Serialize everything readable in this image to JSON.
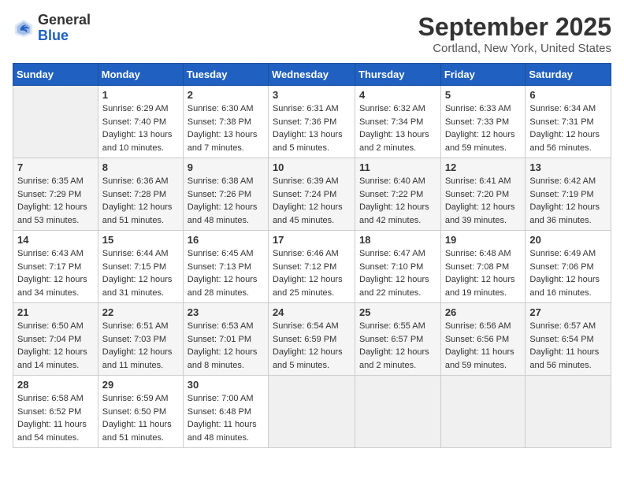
{
  "logo": {
    "general": "General",
    "blue": "Blue"
  },
  "title": "September 2025",
  "location": "Cortland, New York, United States",
  "days_of_week": [
    "Sunday",
    "Monday",
    "Tuesday",
    "Wednesday",
    "Thursday",
    "Friday",
    "Saturday"
  ],
  "weeks": [
    [
      {
        "num": "",
        "sunrise": "",
        "sunset": "",
        "daylight": "",
        "empty": true
      },
      {
        "num": "1",
        "sunrise": "Sunrise: 6:29 AM",
        "sunset": "Sunset: 7:40 PM",
        "daylight": "Daylight: 13 hours and 10 minutes."
      },
      {
        "num": "2",
        "sunrise": "Sunrise: 6:30 AM",
        "sunset": "Sunset: 7:38 PM",
        "daylight": "Daylight: 13 hours and 7 minutes."
      },
      {
        "num": "3",
        "sunrise": "Sunrise: 6:31 AM",
        "sunset": "Sunset: 7:36 PM",
        "daylight": "Daylight: 13 hours and 5 minutes."
      },
      {
        "num": "4",
        "sunrise": "Sunrise: 6:32 AM",
        "sunset": "Sunset: 7:34 PM",
        "daylight": "Daylight: 13 hours and 2 minutes."
      },
      {
        "num": "5",
        "sunrise": "Sunrise: 6:33 AM",
        "sunset": "Sunset: 7:33 PM",
        "daylight": "Daylight: 12 hours and 59 minutes."
      },
      {
        "num": "6",
        "sunrise": "Sunrise: 6:34 AM",
        "sunset": "Sunset: 7:31 PM",
        "daylight": "Daylight: 12 hours and 56 minutes."
      }
    ],
    [
      {
        "num": "7",
        "sunrise": "Sunrise: 6:35 AM",
        "sunset": "Sunset: 7:29 PM",
        "daylight": "Daylight: 12 hours and 53 minutes."
      },
      {
        "num": "8",
        "sunrise": "Sunrise: 6:36 AM",
        "sunset": "Sunset: 7:28 PM",
        "daylight": "Daylight: 12 hours and 51 minutes."
      },
      {
        "num": "9",
        "sunrise": "Sunrise: 6:38 AM",
        "sunset": "Sunset: 7:26 PM",
        "daylight": "Daylight: 12 hours and 48 minutes."
      },
      {
        "num": "10",
        "sunrise": "Sunrise: 6:39 AM",
        "sunset": "Sunset: 7:24 PM",
        "daylight": "Daylight: 12 hours and 45 minutes."
      },
      {
        "num": "11",
        "sunrise": "Sunrise: 6:40 AM",
        "sunset": "Sunset: 7:22 PM",
        "daylight": "Daylight: 12 hours and 42 minutes."
      },
      {
        "num": "12",
        "sunrise": "Sunrise: 6:41 AM",
        "sunset": "Sunset: 7:20 PM",
        "daylight": "Daylight: 12 hours and 39 minutes."
      },
      {
        "num": "13",
        "sunrise": "Sunrise: 6:42 AM",
        "sunset": "Sunset: 7:19 PM",
        "daylight": "Daylight: 12 hours and 36 minutes."
      }
    ],
    [
      {
        "num": "14",
        "sunrise": "Sunrise: 6:43 AM",
        "sunset": "Sunset: 7:17 PM",
        "daylight": "Daylight: 12 hours and 34 minutes."
      },
      {
        "num": "15",
        "sunrise": "Sunrise: 6:44 AM",
        "sunset": "Sunset: 7:15 PM",
        "daylight": "Daylight: 12 hours and 31 minutes."
      },
      {
        "num": "16",
        "sunrise": "Sunrise: 6:45 AM",
        "sunset": "Sunset: 7:13 PM",
        "daylight": "Daylight: 12 hours and 28 minutes."
      },
      {
        "num": "17",
        "sunrise": "Sunrise: 6:46 AM",
        "sunset": "Sunset: 7:12 PM",
        "daylight": "Daylight: 12 hours and 25 minutes."
      },
      {
        "num": "18",
        "sunrise": "Sunrise: 6:47 AM",
        "sunset": "Sunset: 7:10 PM",
        "daylight": "Daylight: 12 hours and 22 minutes."
      },
      {
        "num": "19",
        "sunrise": "Sunrise: 6:48 AM",
        "sunset": "Sunset: 7:08 PM",
        "daylight": "Daylight: 12 hours and 19 minutes."
      },
      {
        "num": "20",
        "sunrise": "Sunrise: 6:49 AM",
        "sunset": "Sunset: 7:06 PM",
        "daylight": "Daylight: 12 hours and 16 minutes."
      }
    ],
    [
      {
        "num": "21",
        "sunrise": "Sunrise: 6:50 AM",
        "sunset": "Sunset: 7:04 PM",
        "daylight": "Daylight: 12 hours and 14 minutes."
      },
      {
        "num": "22",
        "sunrise": "Sunrise: 6:51 AM",
        "sunset": "Sunset: 7:03 PM",
        "daylight": "Daylight: 12 hours and 11 minutes."
      },
      {
        "num": "23",
        "sunrise": "Sunrise: 6:53 AM",
        "sunset": "Sunset: 7:01 PM",
        "daylight": "Daylight: 12 hours and 8 minutes."
      },
      {
        "num": "24",
        "sunrise": "Sunrise: 6:54 AM",
        "sunset": "Sunset: 6:59 PM",
        "daylight": "Daylight: 12 hours and 5 minutes."
      },
      {
        "num": "25",
        "sunrise": "Sunrise: 6:55 AM",
        "sunset": "Sunset: 6:57 PM",
        "daylight": "Daylight: 12 hours and 2 minutes."
      },
      {
        "num": "26",
        "sunrise": "Sunrise: 6:56 AM",
        "sunset": "Sunset: 6:56 PM",
        "daylight": "Daylight: 11 hours and 59 minutes."
      },
      {
        "num": "27",
        "sunrise": "Sunrise: 6:57 AM",
        "sunset": "Sunset: 6:54 PM",
        "daylight": "Daylight: 11 hours and 56 minutes."
      }
    ],
    [
      {
        "num": "28",
        "sunrise": "Sunrise: 6:58 AM",
        "sunset": "Sunset: 6:52 PM",
        "daylight": "Daylight: 11 hours and 54 minutes."
      },
      {
        "num": "29",
        "sunrise": "Sunrise: 6:59 AM",
        "sunset": "Sunset: 6:50 PM",
        "daylight": "Daylight: 11 hours and 51 minutes."
      },
      {
        "num": "30",
        "sunrise": "Sunrise: 7:00 AM",
        "sunset": "Sunset: 6:48 PM",
        "daylight": "Daylight: 11 hours and 48 minutes."
      },
      {
        "num": "",
        "sunrise": "",
        "sunset": "",
        "daylight": "",
        "empty": true
      },
      {
        "num": "",
        "sunrise": "",
        "sunset": "",
        "daylight": "",
        "empty": true
      },
      {
        "num": "",
        "sunrise": "",
        "sunset": "",
        "daylight": "",
        "empty": true
      },
      {
        "num": "",
        "sunrise": "",
        "sunset": "",
        "daylight": "",
        "empty": true
      }
    ]
  ]
}
